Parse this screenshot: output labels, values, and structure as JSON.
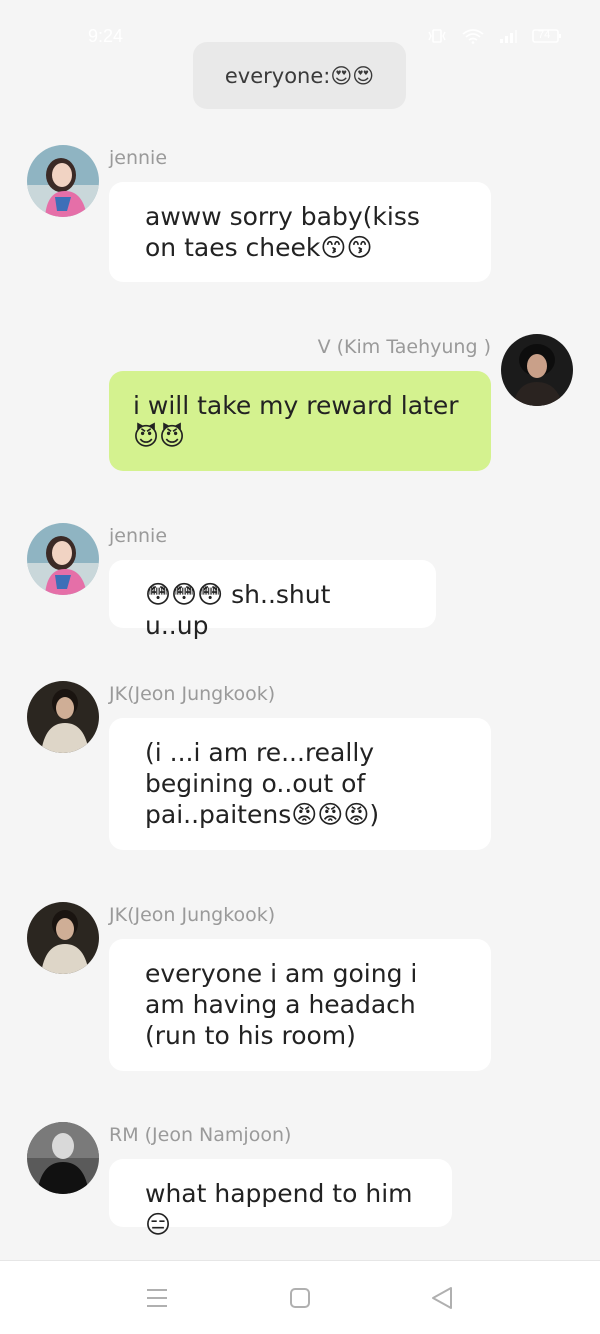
{
  "status_bar": {
    "time": "9:24",
    "battery": "74"
  },
  "system_message": {
    "text": "everyone:😍😍"
  },
  "messages": [
    {
      "sender": "jennie",
      "text": "awww sorry baby(kiss on taes cheek😙😙",
      "side": "left",
      "avatar_icon": "jennie-avatar"
    },
    {
      "sender": "V (Kim Taehyung )",
      "text": "i will take my reward later 😈😈",
      "side": "right",
      "avatar_icon": "v-avatar"
    },
    {
      "sender": "jennie",
      "text": "😳😳😳 sh..shut u..up",
      "side": "left",
      "avatar_icon": "jennie-avatar"
    },
    {
      "sender": "JK(Jeon Jungkook)",
      "text": "(i  ...i am re...really begining o..out of pai..paitens😡😡😡)",
      "side": "left",
      "avatar_icon": "jk-avatar"
    },
    {
      "sender": "JK(Jeon Jungkook)",
      "text": "everyone i am going i am having a headach (run to his room)",
      "side": "left",
      "avatar_icon": "jk-avatar"
    },
    {
      "sender": "RM (Jeon Namjoon)",
      "text": "what happend to him😑",
      "side": "left",
      "avatar_icon": "rm-avatar"
    }
  ],
  "nav_bar": {
    "menu_icon": "menu-icon",
    "home_icon": "home-icon",
    "back_icon": "back-icon"
  },
  "colors": {
    "background": "#f5f5f5",
    "incoming_bubble": "#ffffff",
    "outgoing_bubble": "#d4f28f",
    "system_bubble": "#e9e9e9",
    "sender_name": "#9a9a9a"
  }
}
